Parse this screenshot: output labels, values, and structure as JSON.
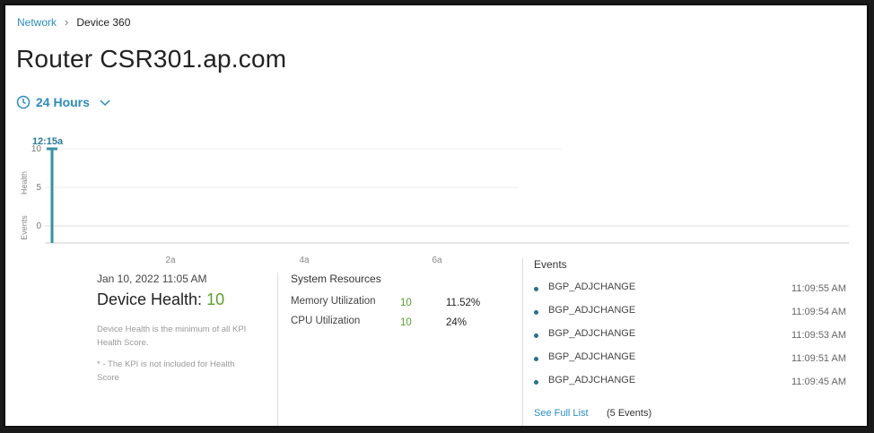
{
  "breadcrumb": {
    "parent": "Network",
    "current": "Device 360"
  },
  "title": "Router CSR301.ap.com",
  "time_range": {
    "label": "24 Hours"
  },
  "chart": {
    "marker_label": "12:15a",
    "y_axis_label_health": "Health",
    "y_axis_label_events": "Events",
    "y_ticks": [
      "10",
      "5",
      "0"
    ],
    "x_ticks": [
      "2a",
      "4a",
      "6a"
    ]
  },
  "chart_data": {
    "type": "bar",
    "categories": [
      "12:15a"
    ],
    "values": [
      10
    ],
    "ylim": [
      0,
      10
    ],
    "ylabel": "Health",
    "x_tick_labels": [
      "2a",
      "4a",
      "6a"
    ],
    "y_tick_labels": [
      "0",
      "5",
      "10"
    ]
  },
  "device_health": {
    "date": "Jan 10, 2022 11:05 AM",
    "label": "Device Health:",
    "score": "10",
    "description": "Device Health is the minimum of all KPI Health Score.",
    "note": "* - The KPI is not included for Health Score"
  },
  "system_resources": {
    "title": "System Resources",
    "rows": [
      {
        "label": "Memory Utilization",
        "score": "10",
        "value": "11.52%"
      },
      {
        "label": "CPU Utilization",
        "score": "10",
        "value": "24%"
      }
    ]
  },
  "events": {
    "title": "Events",
    "items": [
      {
        "name": "BGP_ADJCHANGE",
        "time": "11:09:55 AM"
      },
      {
        "name": "BGP_ADJCHANGE",
        "time": "11:09:54 AM"
      },
      {
        "name": "BGP_ADJCHANGE",
        "time": "11:09:53 AM"
      },
      {
        "name": "BGP_ADJCHANGE",
        "time": "11:09:51 AM"
      },
      {
        "name": "BGP_ADJCHANGE",
        "time": "11:09:45 AM"
      }
    ],
    "see_full_label": "See Full List",
    "count_label": "(5 Events)"
  },
  "colors": {
    "accent": "#2b8cbe",
    "good": "#5aa02c",
    "bar": "#3a8fa3"
  }
}
